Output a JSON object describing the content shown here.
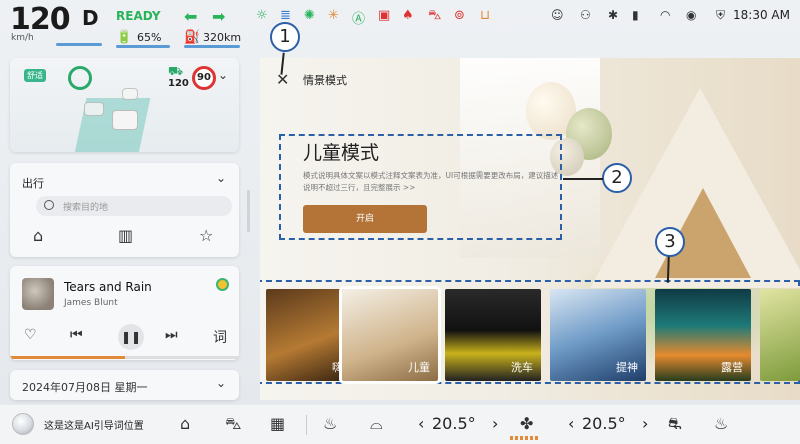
{
  "status": {
    "speed": "120",
    "speed_unit": "km/h",
    "gear": "D",
    "ready": "READY",
    "battery_pct": "65%",
    "range": "320km",
    "time": "18:30 AM"
  },
  "adas": {
    "mode_tag": "舒适",
    "cruise_speed": "120",
    "speed_limit": "90"
  },
  "nav": {
    "title": "出行",
    "search_placeholder": "搜索目的地"
  },
  "music": {
    "song": "Tears and Rain",
    "artist": "James Blunt",
    "lyrics_label": "词",
    "progress": 0.5
  },
  "date": {
    "text": "2024年07月08日 星期一"
  },
  "scene": {
    "header": "情景模式",
    "hero_title": "儿童模式",
    "hero_desc": "模式说明具体文案以模式注释文案表为准，UI可根据需要更改布局，建议描述说明不超过三行，且完整展示 >>",
    "open_button": "开启",
    "callouts": [
      "1",
      "2",
      "3"
    ],
    "thumbnails": [
      {
        "label": "嗨歌"
      },
      {
        "label": "儿童"
      },
      {
        "label": "洗车"
      },
      {
        "label": "提神"
      },
      {
        "label": "露营"
      }
    ]
  },
  "dock": {
    "ai_prompt": "这是这是AI引导词位置",
    "temp_left": "20.5°",
    "temp_right": "20.5°"
  },
  "colors": {
    "accent_green": "#29b35a",
    "brand_brown": "#b47438",
    "callout_blue": "#2b5fa8"
  }
}
